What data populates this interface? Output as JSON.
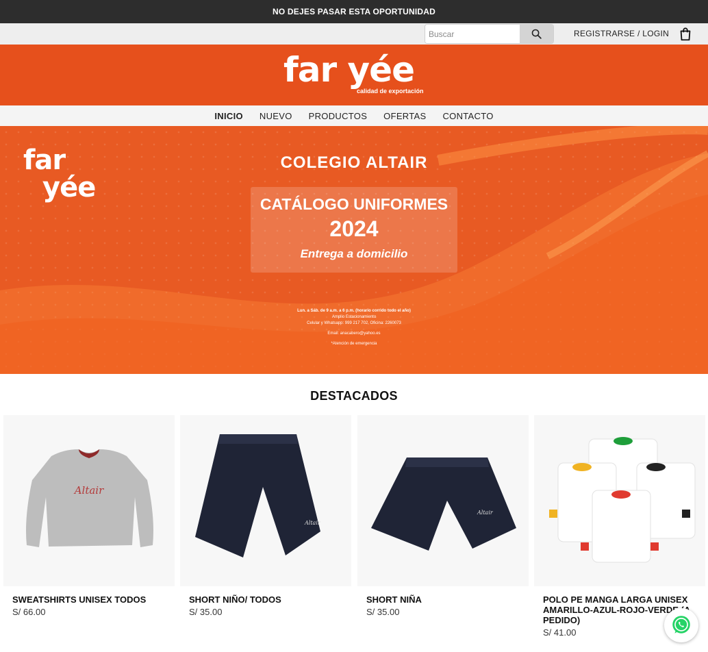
{
  "promo": {
    "text": "NO DEJES PASAR ESTA OPORTUNIDAD"
  },
  "utility": {
    "search_placeholder": "Buscar",
    "login_label": "REGISTRARSE / LOGIN"
  },
  "brand": {
    "name": "far yée",
    "tagline": "calidad de exportación",
    "color": "#e6501c"
  },
  "nav": {
    "items": [
      "INICIO",
      "NUEVO",
      "PRODUCTOS",
      "OFERTAS",
      "CONTACTO"
    ],
    "active": "INICIO"
  },
  "hero": {
    "logo_line1": "far",
    "logo_line2": "yée",
    "school": "COLEGIO ALTAIR",
    "catalog_title": "CATÁLOGO UNIFORMES",
    "year": "2024",
    "delivery": "Entrega a domicilio",
    "hours": "Lun. a Sáb. de 9 a.m. a 6 p.m. (horario corrido todo el año)",
    "parking": "Amplio Estacionamiento",
    "phones": "Celular y Whatsapp: 999 217 702, Oficina: 2260073",
    "email": "Email: anacabero@yahoo.es",
    "emergency": "*Atención de emergencia"
  },
  "featured": {
    "title": "DESTACADOS",
    "products": [
      {
        "name": "SWEATSHIRTS UNISEX TODOS",
        "price": "S/ 66.00"
      },
      {
        "name": "SHORT NIÑO/ TODOS",
        "price": "S/ 35.00"
      },
      {
        "name": "SHORT NIÑA",
        "price": "S/ 35.00"
      },
      {
        "name": "POLO PE MANGA LARGA UNISEX AMARILLO-AZUL-ROJO-VERDE (A PEDIDO)",
        "price": "S/ 41.00"
      }
    ]
  },
  "icons": [
    "search-icon",
    "cart-icon",
    "whatsapp-icon"
  ],
  "colors": {
    "orange": "#e6501c",
    "dark_bar": "#2d2d2d",
    "whatsapp": "#25d366"
  }
}
